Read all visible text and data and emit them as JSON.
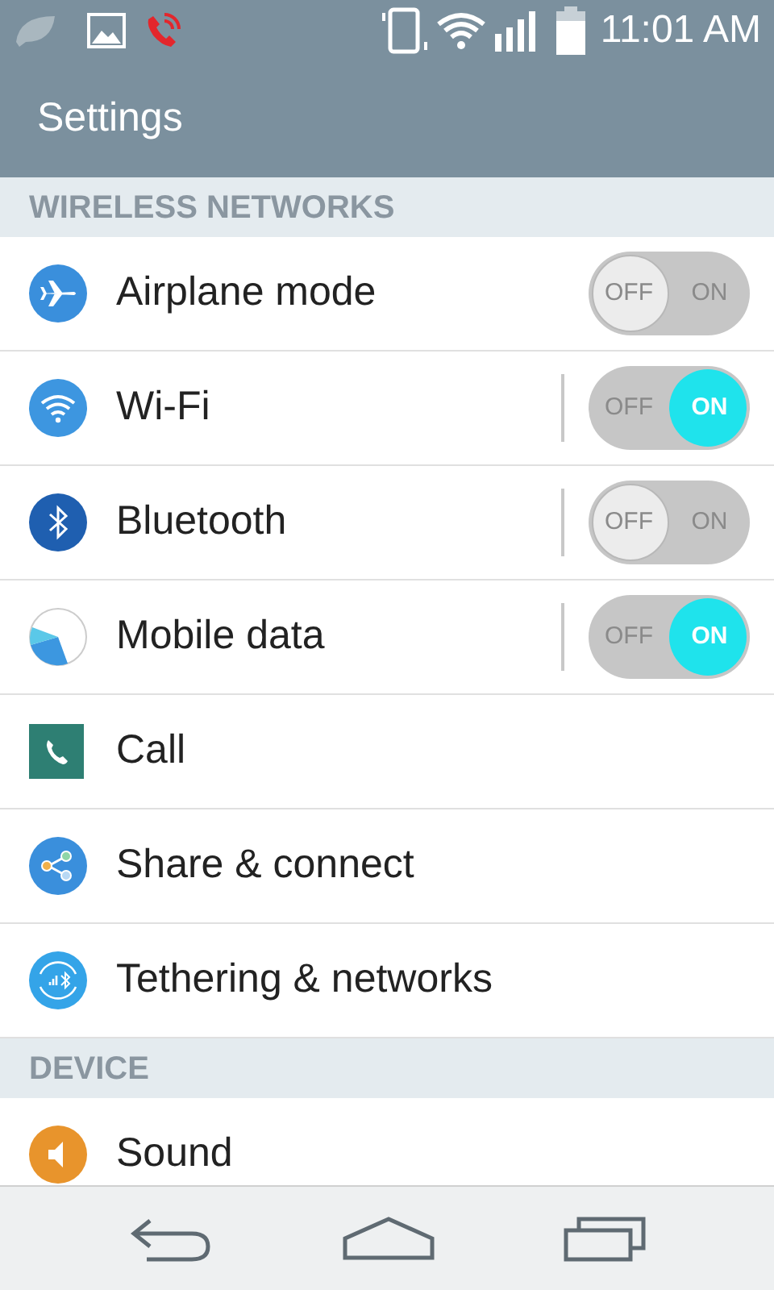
{
  "status_bar": {
    "time": "11:01 AM"
  },
  "header": {
    "title": "Settings"
  },
  "sections": [
    {
      "title": "WIRELESS NETWORKS",
      "items": [
        {
          "label": "Airplane mode",
          "kind": "toggle",
          "on": false,
          "split": false,
          "off_text": "OFF",
          "on_text": "ON"
        },
        {
          "label": "Wi-Fi",
          "kind": "toggle",
          "on": true,
          "split": true,
          "off_text": "OFF",
          "on_text": "ON"
        },
        {
          "label": "Bluetooth",
          "kind": "toggle",
          "on": false,
          "split": true,
          "off_text": "OFF",
          "on_text": "ON"
        },
        {
          "label": "Mobile data",
          "kind": "toggle",
          "on": true,
          "split": true,
          "off_text": "OFF",
          "on_text": "ON"
        },
        {
          "label": "Call",
          "kind": "link"
        },
        {
          "label": "Share & connect",
          "kind": "link"
        },
        {
          "label": "Tethering & networks",
          "kind": "link"
        }
      ]
    },
    {
      "title": "DEVICE",
      "items": [
        {
          "label": "Sound",
          "kind": "link"
        }
      ]
    }
  ]
}
